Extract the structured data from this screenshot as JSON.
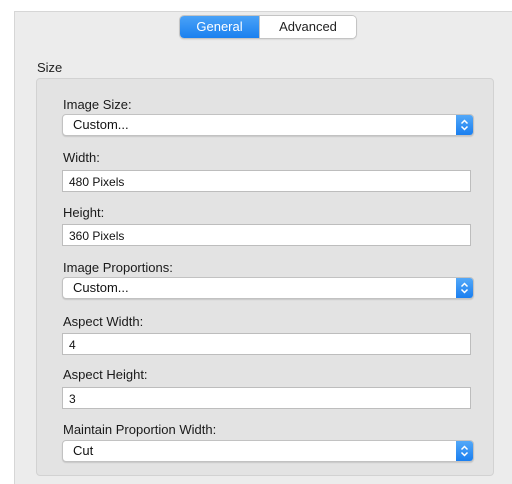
{
  "tabs": {
    "general": "General",
    "advanced": "Advanced"
  },
  "section": {
    "title": "Size"
  },
  "fields": {
    "image_size": {
      "label": "Image Size:",
      "value": "Custom..."
    },
    "width": {
      "label": "Width:",
      "value": "480 Pixels"
    },
    "height": {
      "label": "Height:",
      "value": "360 Pixels"
    },
    "image_proportions": {
      "label": "Image Proportions:",
      "value": "Custom..."
    },
    "aspect_width": {
      "label": "Aspect Width:",
      "value": "4"
    },
    "aspect_height": {
      "label": "Aspect Height:",
      "value": "3"
    },
    "maintain_proportion_width": {
      "label": "Maintain Proportion Width:",
      "value": "Cut"
    }
  },
  "colors": {
    "accent": "#1a80ef",
    "window_bg": "#ececec",
    "group_bg": "#e3e3e3"
  },
  "icons": {
    "popup": "chevron-up-down-icon"
  }
}
